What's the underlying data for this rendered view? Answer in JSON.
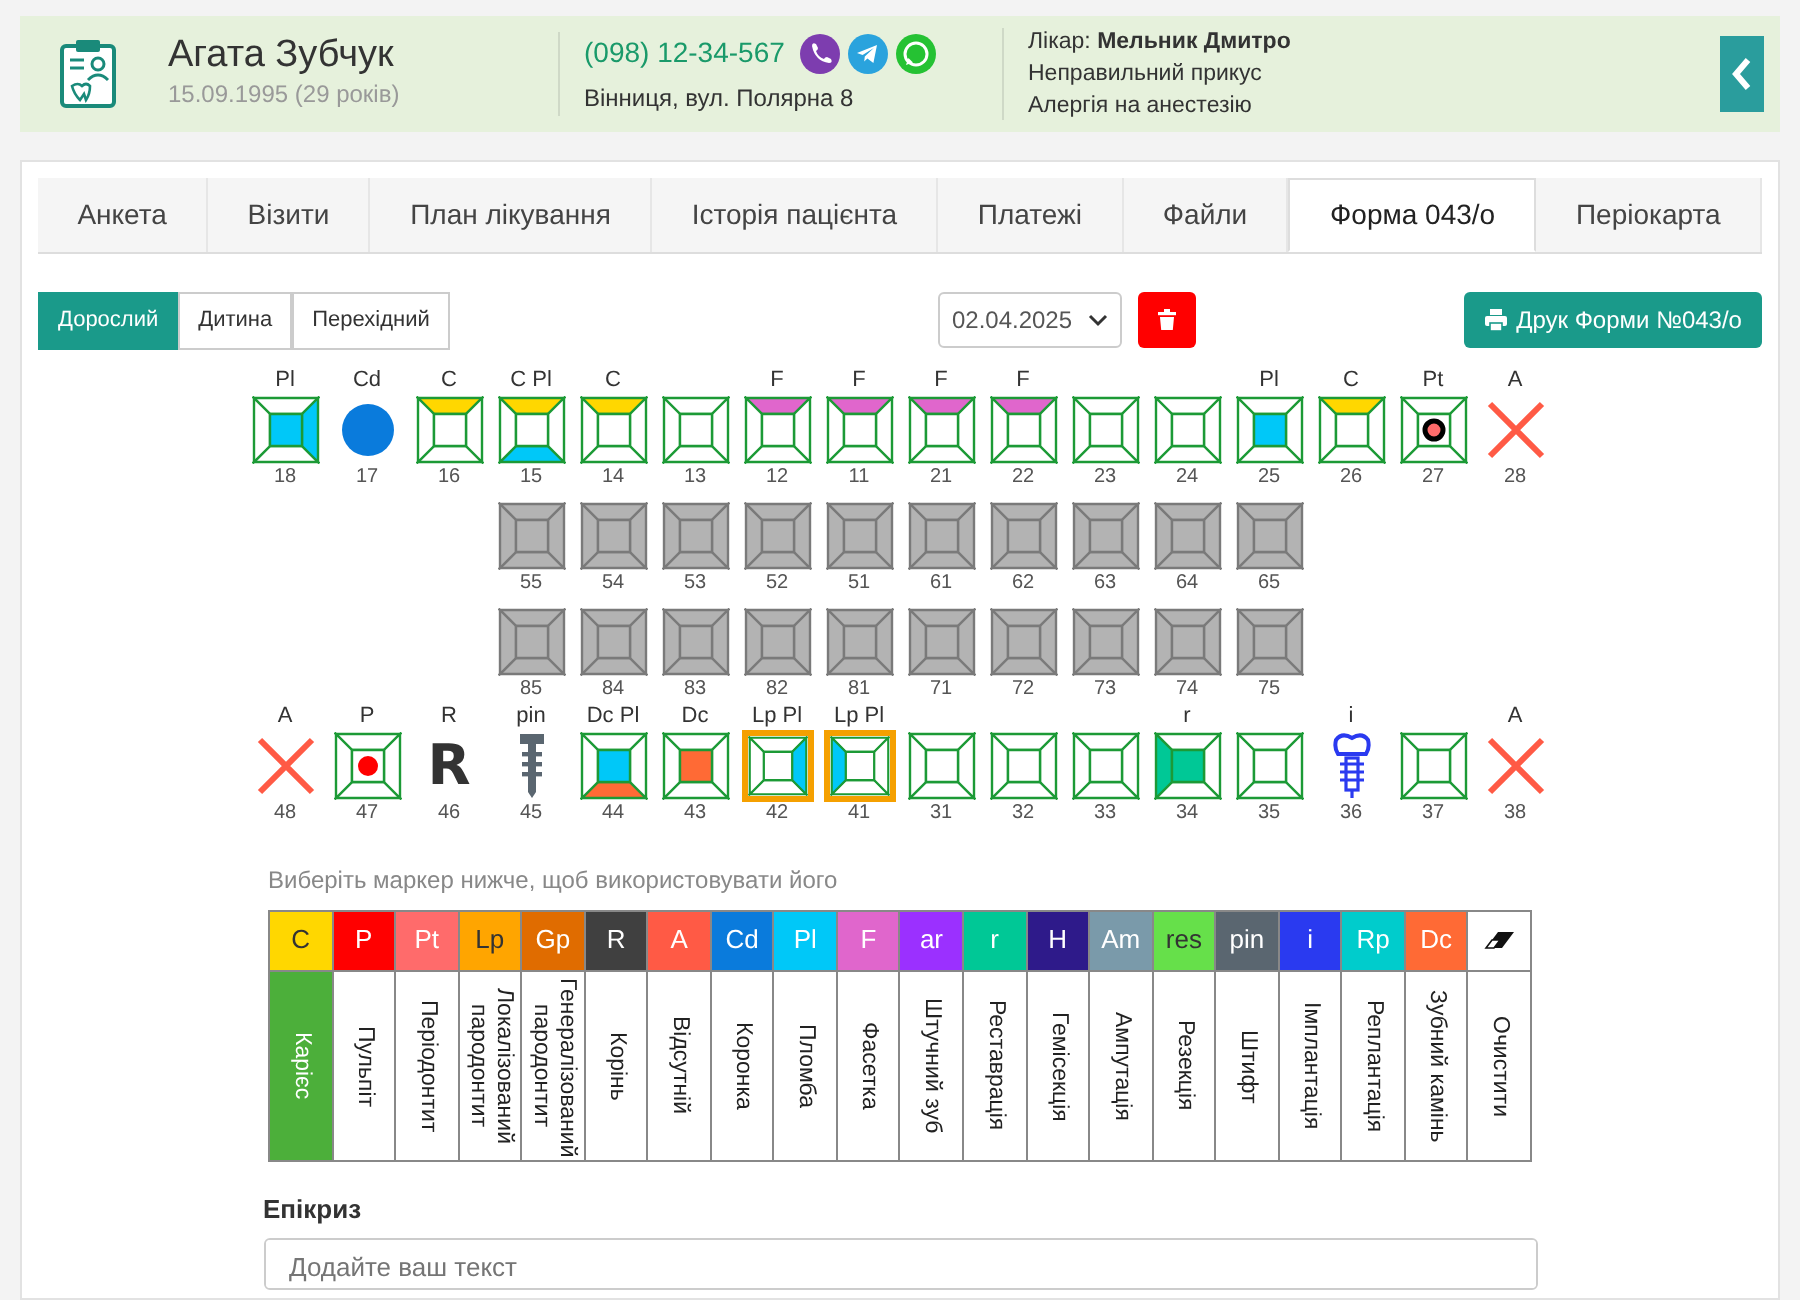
{
  "patient": {
    "name": "Агата Зубчук",
    "birth": "15.09.1995 (29 років)",
    "phone": "(098) 12-34-567",
    "address": "Вінниця, вул. Полярна 8",
    "doctor": "Лікар: **Мельник Дмитро**",
    "notes": [
      "Неправильний прикус",
      "Алергія на анестезію"
    ]
  },
  "tabs": [
    {
      "label": "Анкета",
      "selected": false
    },
    {
      "label": "Візити",
      "selected": false
    },
    {
      "label": "План лікування",
      "selected": false
    },
    {
      "label": "Історія пацієнта",
      "selected": false
    },
    {
      "label": "Платежі",
      "selected": false
    },
    {
      "label": "Файли",
      "selected": false
    },
    {
      "label": "Форма 043/о",
      "selected": true
    },
    {
      "label": "Періокарта",
      "selected": false
    }
  ],
  "age_modes": [
    {
      "label": "Дорослий",
      "selected": true
    },
    {
      "label": "Дитина",
      "selected": false
    },
    {
      "label": "Перехідний",
      "selected": false
    }
  ],
  "date": "02.04.2025",
  "print_button": "Друк Форми №043/о",
  "upper_teeth": [
    {
      "number": "18",
      "label": "Pl",
      "kind": "surface",
      "surfaces": [
        {
          "kind": "center",
          "color": "#00c8f8"
        },
        {
          "kind": "right",
          "color": "#00c8f8"
        }
      ]
    },
    {
      "number": "17",
      "label": "Cd",
      "kind": "crown",
      "color": "#0a7bdc"
    },
    {
      "number": "16",
      "label": "C",
      "kind": "surface",
      "surfaces": [
        {
          "kind": "top",
          "color": "#ffd700"
        }
      ]
    },
    {
      "number": "15",
      "label": "C Pl",
      "kind": "surface",
      "surfaces": [
        {
          "kind": "top",
          "color": "#ffd700"
        },
        {
          "kind": "bottom",
          "color": "#00c8f8"
        }
      ]
    },
    {
      "number": "14",
      "label": "C",
      "kind": "surface",
      "surfaces": [
        {
          "kind": "top",
          "color": "#ffd700"
        }
      ]
    },
    {
      "number": "13",
      "kind": "surface"
    },
    {
      "number": "12",
      "label": "F",
      "kind": "surface",
      "surfaces": [
        {
          "kind": "top",
          "color": "#e066cc"
        }
      ]
    },
    {
      "number": "11",
      "label": "F",
      "kind": "surface",
      "surfaces": [
        {
          "kind": "top",
          "color": "#e066cc"
        }
      ]
    },
    {
      "number": "21",
      "label": "F",
      "kind": "surface",
      "surfaces": [
        {
          "kind": "top",
          "color": "#e066cc"
        }
      ]
    },
    {
      "number": "22",
      "label": "F",
      "kind": "surface",
      "surfaces": [
        {
          "kind": "top",
          "color": "#e066cc"
        }
      ]
    },
    {
      "number": "23",
      "kind": "surface"
    },
    {
      "number": "24",
      "kind": "surface"
    },
    {
      "number": "25",
      "label": "Pl",
      "kind": "surface",
      "surfaces": [
        {
          "kind": "center",
          "color": "#00c8f8"
        }
      ]
    },
    {
      "number": "26",
      "label": "C",
      "kind": "surface",
      "surfaces": [
        {
          "kind": "top",
          "color": "#ffd700"
        }
      ]
    },
    {
      "number": "27",
      "label": "Pt",
      "kind": "surface",
      "dot": {
        "color": "#ff6b6b",
        "ringed": true
      }
    },
    {
      "number": "28",
      "label": "A",
      "kind": "absent"
    }
  ],
  "primary_upper": [
    {
      "number": "55",
      "kind": "primary"
    },
    {
      "number": "54",
      "kind": "primary"
    },
    {
      "number": "53",
      "kind": "primary"
    },
    {
      "number": "52",
      "kind": "primary"
    },
    {
      "number": "51",
      "kind": "primary"
    },
    {
      "number": "61",
      "kind": "primary"
    },
    {
      "number": "62",
      "kind": "primary"
    },
    {
      "number": "63",
      "kind": "primary"
    },
    {
      "number": "64",
      "kind": "primary"
    },
    {
      "number": "65",
      "kind": "primary"
    }
  ],
  "primary_lower": [
    {
      "number": "85",
      "kind": "primary"
    },
    {
      "number": "84",
      "kind": "primary"
    },
    {
      "number": "83",
      "kind": "primary"
    },
    {
      "number": "82",
      "kind": "primary"
    },
    {
      "number": "81",
      "kind": "primary"
    },
    {
      "number": "71",
      "kind": "primary"
    },
    {
      "number": "72",
      "kind": "primary"
    },
    {
      "number": "73",
      "kind": "primary"
    },
    {
      "number": "74",
      "kind": "primary"
    },
    {
      "number": "75",
      "kind": "primary"
    }
  ],
  "lower_teeth": [
    {
      "number": "48",
      "label": "A",
      "kind": "absent",
      "highlighted": false
    },
    {
      "number": "47",
      "label": "P",
      "kind": "surface",
      "dot": {
        "color": "#ff0000",
        "ringed": false
      },
      "highlighted": false
    },
    {
      "number": "46",
      "label": "R",
      "kind": "root",
      "glyph": "R",
      "highlighted": false
    },
    {
      "number": "45",
      "label": "pin",
      "kind": "pin",
      "highlighted": false
    },
    {
      "number": "44",
      "label": "Dc Pl",
      "kind": "surface",
      "surfaces": [
        {
          "kind": "center",
          "color": "#00c8f8"
        },
        {
          "kind": "bottom",
          "color": "#ff6a35"
        }
      ],
      "highlighted": false
    },
    {
      "number": "43",
      "label": "Dc",
      "kind": "surface",
      "surfaces": [
        {
          "kind": "center",
          "color": "#ff6a35"
        }
      ],
      "highlighted": false
    },
    {
      "number": "42",
      "label": "Lp Pl",
      "kind": "surface",
      "surfaces": [
        {
          "kind": "right",
          "color": "#00c8f8"
        }
      ],
      "highlighted": true
    },
    {
      "number": "41",
      "label": "Lp Pl",
      "kind": "surface",
      "surfaces": [
        {
          "kind": "left",
          "color": "#00c8f8"
        }
      ],
      "highlighted": true
    },
    {
      "number": "31",
      "kind": "surface",
      "highlighted": false
    },
    {
      "number": "32",
      "kind": "surface",
      "highlighted": false
    },
    {
      "number": "33",
      "kind": "surface",
      "highlighted": false
    },
    {
      "number": "34",
      "label": "r",
      "kind": "surface",
      "surfaces": [
        {
          "kind": "center",
          "color": "#00c896"
        },
        {
          "kind": "left",
          "color": "#00c896"
        }
      ],
      "highlighted": false
    },
    {
      "number": "35",
      "kind": "surface",
      "highlighted": false
    },
    {
      "number": "36",
      "label": "i",
      "kind": "implant",
      "highlighted": false
    },
    {
      "number": "37",
      "kind": "surface",
      "highlighted": false
    },
    {
      "number": "38",
      "label": "A",
      "kind": "absent",
      "highlighted": false
    }
  ],
  "marker_hint": "Виберіть маркер нижче, щоб використовувати його",
  "markers": [
    {
      "kind": "marker",
      "code": "C",
      "name": "Карієс",
      "color": "#ffd700",
      "selected": true
    },
    {
      "kind": "marker",
      "code": "P",
      "name": "Пульпіт",
      "color": "#ff0000",
      "selected": false
    },
    {
      "kind": "marker",
      "code": "Pt",
      "name": "Періодонтит",
      "color": "#ff6b6b",
      "selected": false
    },
    {
      "kind": "marker",
      "code": "Lp",
      "name": "Локалізований пародонтит",
      "color": "#ffa500",
      "selected": false
    },
    {
      "kind": "marker",
      "code": "Gp",
      "name": "Генералізований пародонтит",
      "color": "#e06c00",
      "selected": false
    },
    {
      "kind": "marker",
      "code": "R",
      "name": "Корінь",
      "color": "#404040",
      "selected": false
    },
    {
      "kind": "marker",
      "code": "A",
      "name": "Відсутній",
      "color": "#ff5a45",
      "selected": false
    },
    {
      "kind": "marker",
      "code": "Cd",
      "name": "Коронка",
      "color": "#0a7bdc",
      "selected": false
    },
    {
      "kind": "marker",
      "code": "Pl",
      "name": "Пломба",
      "color": "#00c8f8",
      "selected": false
    },
    {
      "kind": "marker",
      "code": "F",
      "name": "Фасетка",
      "color": "#e066cc",
      "selected": false
    },
    {
      "kind": "marker",
      "code": "ar",
      "name": "Штучний зуб",
      "color": "#9b30ff",
      "selected": false
    },
    {
      "kind": "marker",
      "code": "r",
      "name": "Реставрація",
      "color": "#00c896",
      "selected": false
    },
    {
      "kind": "marker",
      "code": "H",
      "name": "Гемісекція",
      "color": "#2e1a8a",
      "selected": false
    },
    {
      "kind": "marker",
      "code": "Am",
      "name": "Ампутація",
      "color": "#7a9aaa",
      "selected": false
    },
    {
      "kind": "marker",
      "code": "res",
      "name": "Резекція",
      "color": "#66e04a",
      "selected": false
    },
    {
      "kind": "marker",
      "code": "pin",
      "name": "Штифт",
      "color": "#5a6670",
      "selected": false
    },
    {
      "kind": "marker",
      "code": "i",
      "name": "Імплантація",
      "color": "#2a3af0",
      "selected": false
    },
    {
      "kind": "marker",
      "code": "Rp",
      "name": "Реплантація",
      "color": "#00cccc",
      "selected": false
    },
    {
      "kind": "marker",
      "code": "Dc",
      "name": "Зубний камінь",
      "color": "#ff6a35",
      "selected": false
    },
    {
      "kind": "eraser",
      "name": "Очистити",
      "selected": false
    }
  ],
  "epicrisis": {
    "label": "Епікриз",
    "placeholder": "Додайте ваш текст"
  }
}
